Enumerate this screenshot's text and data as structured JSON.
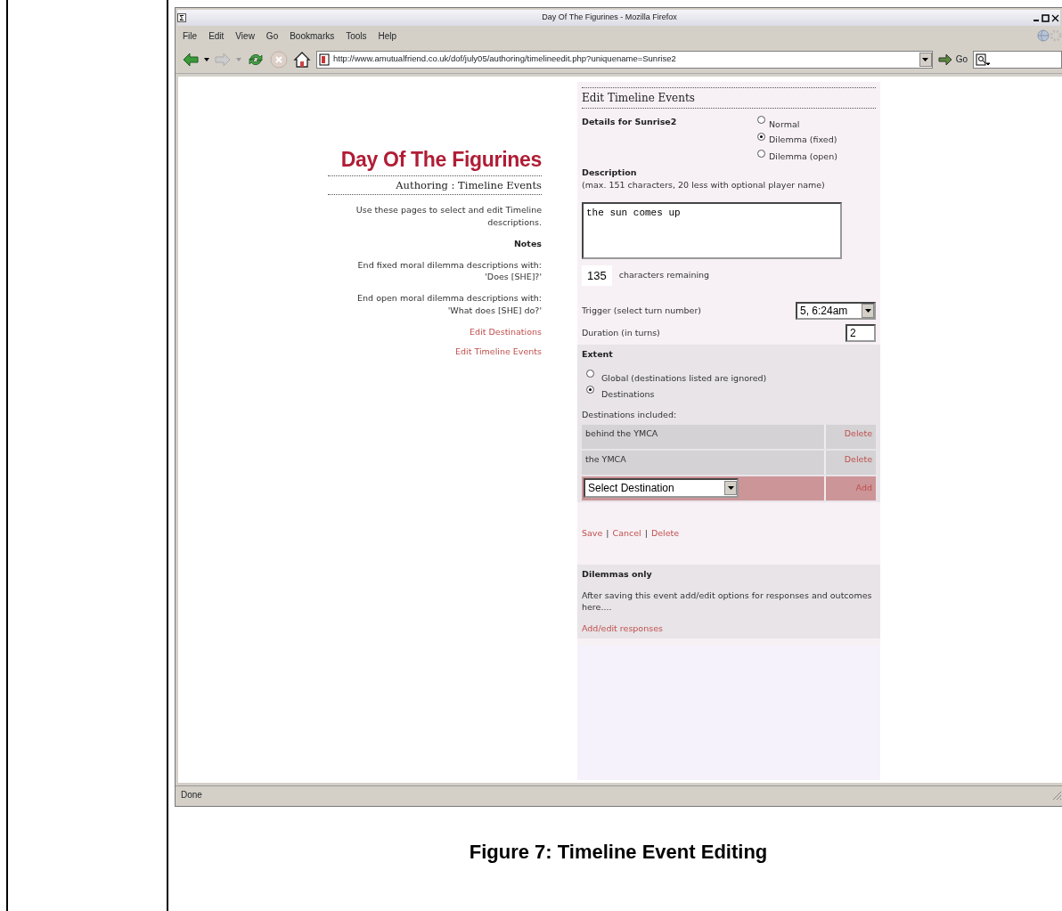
{
  "window": {
    "title": "Day Of The Figurines - Mozilla Firefox"
  },
  "menu": [
    "File",
    "Edit",
    "View",
    "Go",
    "Bookmarks",
    "Tools",
    "Help"
  ],
  "toolbar": {
    "url": "http://www.amutualfriend.co.uk/dof/july05/authoring/timelineedit.php?uniquename=Sunrise2",
    "go_label": "Go"
  },
  "page": {
    "title": "Day Of The Figurines",
    "subtitle": "Authoring : Timeline Events",
    "intro": "Use these pages to select and edit Timeline descriptions.",
    "notes_heading": "Notes",
    "notes": [
      {
        "line1": "End fixed moral dilemma descriptions with:",
        "line2": "'Does [SHE]?'"
      },
      {
        "line1": "End open moral dilemma descriptions with:",
        "line2": "'What does [SHE] do?'"
      }
    ],
    "links": [
      "Edit Destinations",
      "Edit Timeline Events"
    ]
  },
  "form": {
    "heading": "Edit Timeline Events",
    "details": "Details for Sunrise2",
    "types": [
      {
        "label": "Normal",
        "selected": false
      },
      {
        "label": "Dilemma (fixed)",
        "selected": true
      },
      {
        "label": "Dilemma (open)",
        "selected": false
      }
    ],
    "description_label": "Description",
    "description_hint": "(max. 151 characters, 20 less with optional player name)",
    "description_value": "the sun comes up",
    "remaining_count": "135",
    "remaining_label": "characters remaining",
    "trigger_label": "Trigger (select turn number)",
    "trigger_value": "5, 6:24am",
    "duration_label": "Duration (in turns)",
    "duration_value": "2",
    "extent": {
      "heading": "Extent",
      "options": [
        {
          "label": "Global (destinations listed are ignored)",
          "selected": false
        },
        {
          "label": "Destinations",
          "selected": true
        }
      ],
      "included_label": "Destinations included:",
      "destinations": [
        {
          "name": "behind the YMCA",
          "action": "Delete"
        },
        {
          "name": "the YMCA",
          "action": "Delete"
        }
      ],
      "select_value": "Select Destination",
      "add_label": "Add"
    },
    "actions": [
      {
        "kind": "link",
        "text": "Save"
      },
      {
        "kind": "separator",
        "text": "|"
      },
      {
        "kind": "link",
        "text": "Cancel"
      },
      {
        "kind": "separator",
        "text": "|"
      },
      {
        "kind": "link",
        "text": "Delete"
      }
    ],
    "dilemmas": {
      "heading": "Dilemmas only",
      "text": "After saving this event add/edit options for responses and outcomes here....",
      "link": "Add/edit responses"
    }
  },
  "status_bar": "Done",
  "caption": "Figure 7: Timeline Event Editing"
}
